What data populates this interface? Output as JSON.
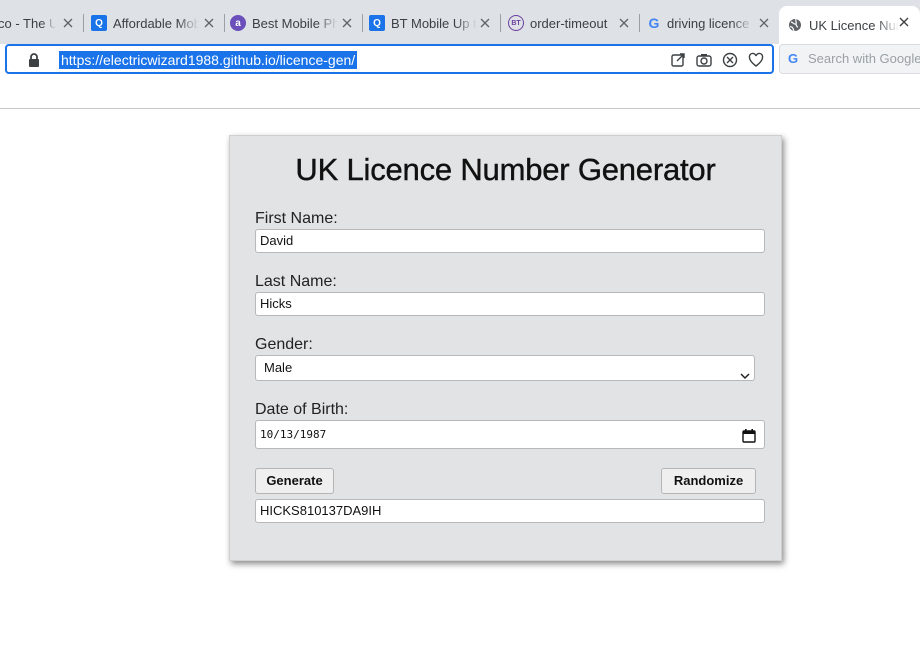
{
  "tabs": [
    {
      "title": "co - The UK",
      "icon": "tesco-favicon"
    },
    {
      "title": "Affordable Mobile",
      "icon": "q-favicon"
    },
    {
      "title": "Best Mobile Phone",
      "icon": "a-favicon"
    },
    {
      "title": "BT Mobile Up to",
      "icon": "q-favicon"
    },
    {
      "title": "order-timeout",
      "icon": "bt-favicon"
    },
    {
      "title": "driving licence n",
      "icon": "google-favicon"
    },
    {
      "title": "UK Licence Number",
      "icon": "globe-favicon"
    }
  ],
  "address_bar": {
    "url": "https://electricwizard1988.github.io/licence-gen/"
  },
  "search_box": {
    "placeholder": "Search with Google"
  },
  "form": {
    "title": "UK Licence Number Generator",
    "first_name_label": "First Name:",
    "first_name_value": "David",
    "last_name_label": "Last Name:",
    "last_name_value": "Hicks",
    "gender_label": "Gender:",
    "gender_value": "Male",
    "dob_label": "Date of Birth:",
    "dob_value": "10/13/1987",
    "generate_label": "Generate",
    "randomize_label": "Randomize",
    "result_value": "HICKS810137DA9IH"
  },
  "colors": {
    "accent": "#1a73e8",
    "card_bg": "#e2e3e4",
    "tabbar_bg": "#dee1e6"
  }
}
